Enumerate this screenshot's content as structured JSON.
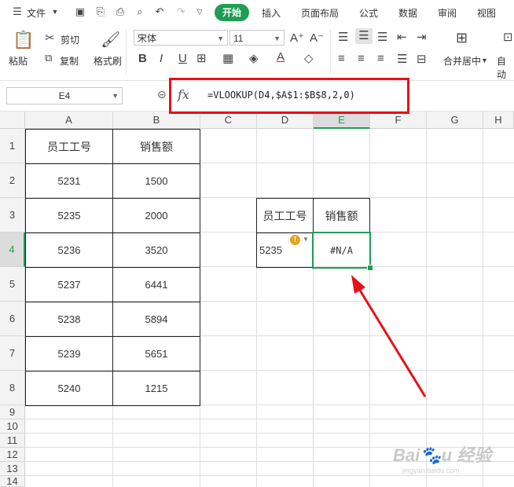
{
  "menubar": {
    "file_label": "文件",
    "tabs": [
      "开始",
      "插入",
      "页面布局",
      "公式",
      "数据",
      "审阅",
      "视图"
    ]
  },
  "ribbon": {
    "paste": "粘贴",
    "cut": "剪切",
    "copy": "复制",
    "format_painter": "格式刷",
    "font_name": "宋体",
    "font_size": "11",
    "merge_center": "合并居中",
    "auto_wrap": "自动"
  },
  "formula_bar": {
    "name_box": "E4",
    "fx": "fx",
    "formula": "=VLOOKUP(D4,$A$1:$B$8,2,0)"
  },
  "columns": [
    "A",
    "B",
    "C",
    "D",
    "E",
    "F",
    "G",
    "H"
  ],
  "rows": [
    "1",
    "2",
    "3",
    "4",
    "5",
    "6",
    "7",
    "8",
    "9",
    "10",
    "11",
    "12",
    "13",
    "14"
  ],
  "table_left": {
    "header": [
      "员工工号",
      "销售额"
    ],
    "rows": [
      [
        "5231",
        "1500"
      ],
      [
        "5235",
        "2000"
      ],
      [
        "5236",
        "3520"
      ],
      [
        "5237",
        "6441"
      ],
      [
        "5238",
        "5894"
      ],
      [
        "5239",
        "5651"
      ],
      [
        "5240",
        "1215"
      ]
    ]
  },
  "table_right": {
    "header": [
      "员工工号",
      "销售额"
    ],
    "lookup_id": "5235",
    "result": "#N/A"
  },
  "selected_cell": "E4",
  "colors": {
    "accent": "#1f9d55",
    "annotation": "#e8101a"
  },
  "watermark": "Baidu 经验 jingyan.baidu.com"
}
